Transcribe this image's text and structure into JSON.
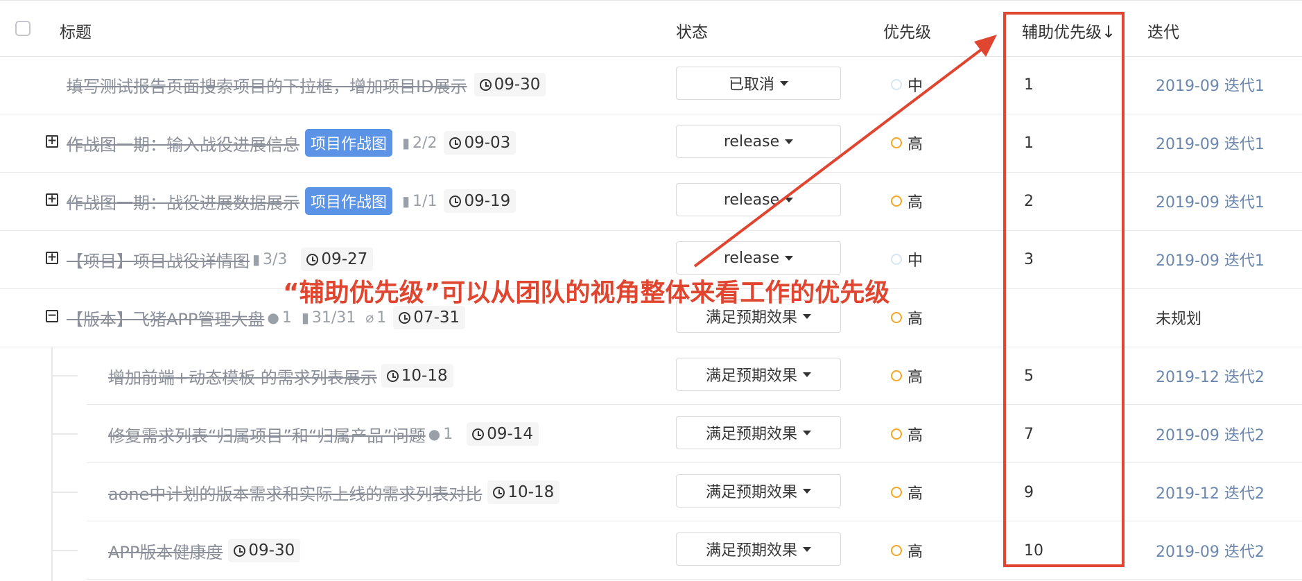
{
  "header": {
    "title": "标题",
    "status": "状态",
    "priority": "优先级",
    "aux_priority": "辅助优先级",
    "sort_arrow": "↓",
    "iteration": "迭代"
  },
  "rows": [
    {
      "title": "填写测试报告页面搜索项目的下拉框，增加项目ID展示",
      "date": "09-30",
      "status": "已取消",
      "priority": "中",
      "aux": "1",
      "iteration": "2019-09 迭代1"
    },
    {
      "expander": "+",
      "title": "作战图一期：输入战役进展信息",
      "tag": "项目作战图",
      "bookmark": "2/2",
      "date": "09-03",
      "status": "release",
      "priority": "高",
      "aux": "1",
      "iteration": "2019-09 迭代1"
    },
    {
      "expander": "+",
      "title": "作战图一期：战役进展数据展示",
      "tag": "项目作战图",
      "bookmark": "1/1",
      "date": "09-19",
      "status": "release",
      "priority": "高",
      "aux": "2",
      "iteration": "2019-09 迭代1"
    },
    {
      "expander": "+",
      "title": "【项目】项目战役详情图",
      "bookmark": "3/3",
      "date": "09-27",
      "status": "release",
      "priority": "中",
      "aux": "3",
      "iteration": "2019-09 迭代1"
    },
    {
      "expander": "−",
      "title": "【版本】飞猪APP管理大盘",
      "comment": "1",
      "bookmark": "31/31",
      "attach": "1",
      "date": "07-31",
      "status": "满足预期效果",
      "priority": "高",
      "aux": "",
      "iteration": "未规划"
    },
    {
      "title": "增加前端+动态模板 的需求列表展示",
      "date": "10-18",
      "status": "满足预期效果",
      "priority": "高",
      "aux": "5",
      "iteration": "2019-12 迭代2"
    },
    {
      "title": "修复需求列表“归属项目”和“归属产品”问题",
      "comment": "1",
      "date": "09-14",
      "status": "满足预期效果",
      "priority": "高",
      "aux": "7",
      "iteration": "2019-09 迭代2"
    },
    {
      "title": "aone中计划的版本需求和实际上线的需求列表对比",
      "date": "10-18",
      "status": "满足预期效果",
      "priority": "高",
      "aux": "9",
      "iteration": "2019-12 迭代2"
    },
    {
      "title": "APP版本健康度",
      "date": "09-30",
      "status": "满足预期效果",
      "priority": "高",
      "aux": "10",
      "iteration": "2019-09 迭代2"
    }
  ],
  "annotation": "“辅助优先级”可以从团队的视角整体来看工作的优先级",
  "colors": {
    "accent_red": "#e0452f",
    "tag_blue": "#5b93e6",
    "high_priority": "#f5a623",
    "mid_priority": "#d6e6f5",
    "iteration_link": "#6b87ad"
  }
}
